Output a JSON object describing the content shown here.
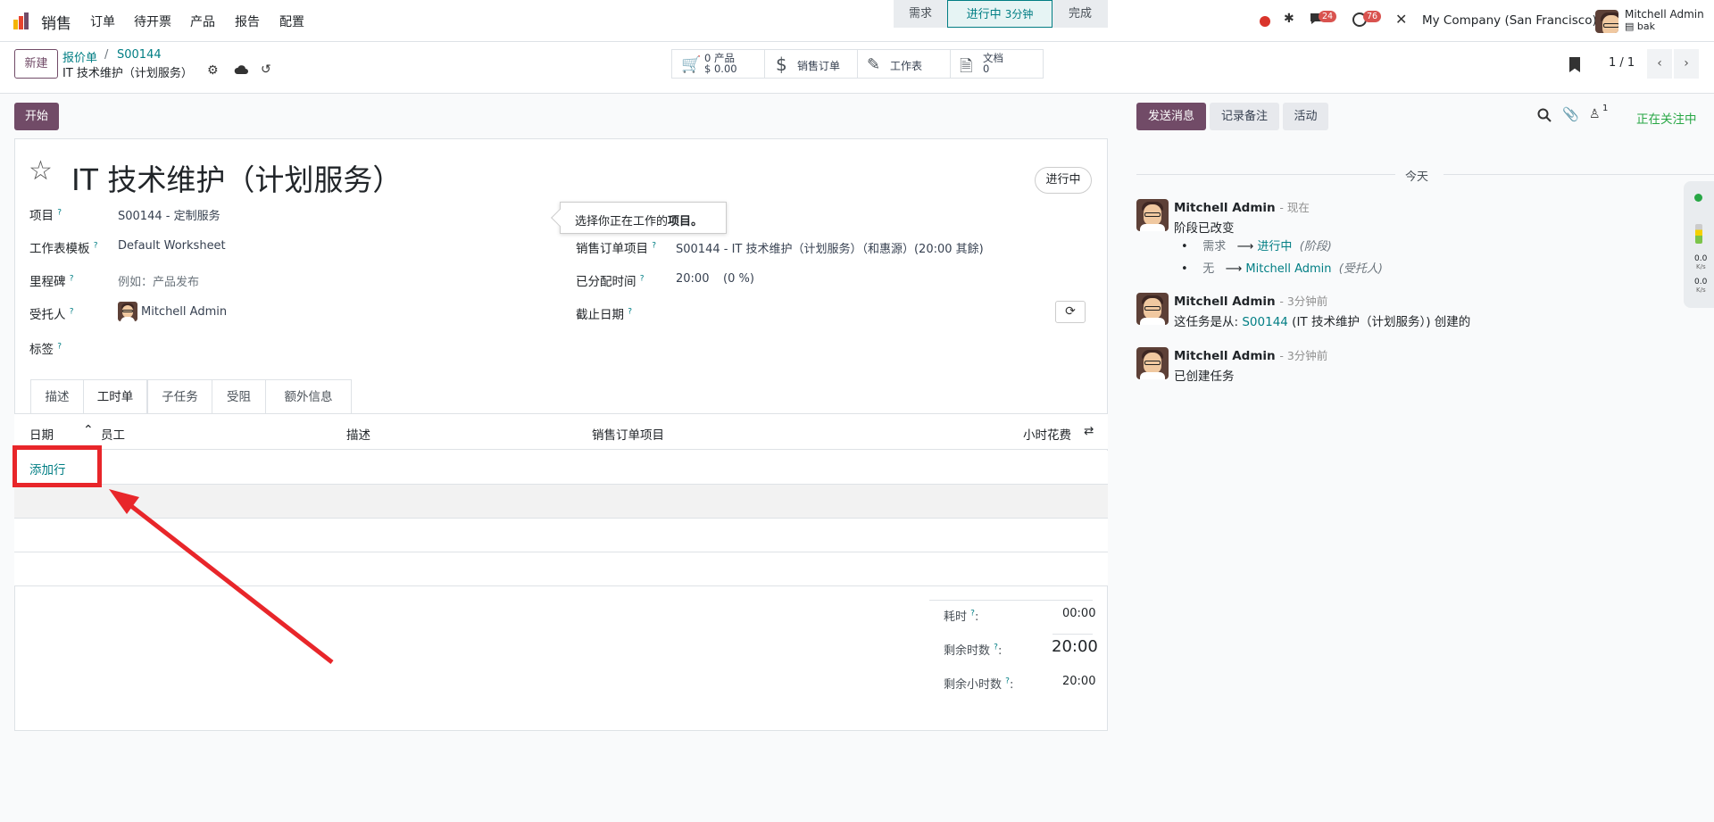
{
  "navbar": {
    "app_name": "销售",
    "menu": [
      "订单",
      "待开票",
      "产品",
      "报告",
      "配置"
    ],
    "messages_badge": "24",
    "activities_badge": "76",
    "company": "My Company (San Francisco)",
    "user_name": "Mitchell Admin",
    "user_db": "bak"
  },
  "control_panel": {
    "new_button": "新建",
    "breadcrumb_parent": "报价单",
    "breadcrumb_order": "S00144",
    "record_title": "IT 技术维护（计划服务）",
    "pager": "1 / 1",
    "smart_buttons": {
      "products_count": "0 产品",
      "products_amount": "$ 0.00",
      "sale_order": "销售订单",
      "worksheet": "工作表",
      "documents_label": "文档",
      "documents_count": "0"
    }
  },
  "form": {
    "start_button": "开始",
    "stages": [
      "需求",
      "进行中",
      "完成"
    ],
    "active_stage_time": "3分钟",
    "title": "IT 技术维护（计划服务）",
    "state_badge": "进行中",
    "tooltip": {
      "text": "选择你正在工作的",
      "bold": "项目。"
    },
    "fields": {
      "project_label": "项目",
      "project_value": "S00144 - 定制服务",
      "worksheet_template_label": "工作表模板",
      "worksheet_template_value": "Default Worksheet",
      "milestone_label": "里程碑",
      "milestone_placeholder": "例如：产品发布",
      "assignee_label": "受托人",
      "assignee_value": "Mitchell Admin",
      "tags_label": "标签",
      "sale_line_label": "销售订单项目",
      "sale_line_value": "S00144 - IT 技术维护（计划服务）（和惠源）(20:00 其餘)",
      "allocated_label": "已分配时间",
      "allocated_value": "20:00",
      "allocated_percent": "(0 %)",
      "deadline_label": "截止日期"
    },
    "tabs": [
      "描述",
      "工时单",
      "子任务",
      "受阻",
      "额外信息"
    ],
    "timesheet": {
      "columns": [
        "日期",
        "员工",
        "描述",
        "销售订单项目",
        "小时花费"
      ],
      "add_line": "添加行"
    },
    "totals": {
      "spent_label": "耗时",
      "spent_value": "00:00",
      "remaining_label": "剩余时数",
      "remaining_value": "20:00",
      "remaining_sub_label": "剩余小时数",
      "remaining_sub_value": "20:00"
    }
  },
  "chatter": {
    "send_message": "发送消息",
    "log_note": "记录备注",
    "activity": "活动",
    "followers_count": "1",
    "following": "正在关注中",
    "date_separator": "今天",
    "messages": [
      {
        "author": "Mitchell Admin",
        "time": "- 现在",
        "body": "阶段已改变",
        "changes": [
          {
            "old": "需求",
            "new": "进行中",
            "field": "(阶段)"
          },
          {
            "old": "无",
            "new": "Mitchell Admin",
            "field": "(受托人)"
          }
        ]
      },
      {
        "author": "Mitchell Admin",
        "time": "- 3分钟前",
        "body_prefix": "这任务是从:",
        "body_link": "S00144",
        "body_suffix": "(IT 技术维护（计划服务）) 创建的"
      },
      {
        "author": "Mitchell Admin",
        "time": "- 3分钟前",
        "body": "已创建任务"
      }
    ]
  },
  "side_widget": {
    "up_value": "0.0",
    "down_value": "0.0",
    "unit": "K/s"
  },
  "colors": {
    "primary": "#714b67",
    "link": "#017e84",
    "annotation_red": "#e8262a"
  }
}
